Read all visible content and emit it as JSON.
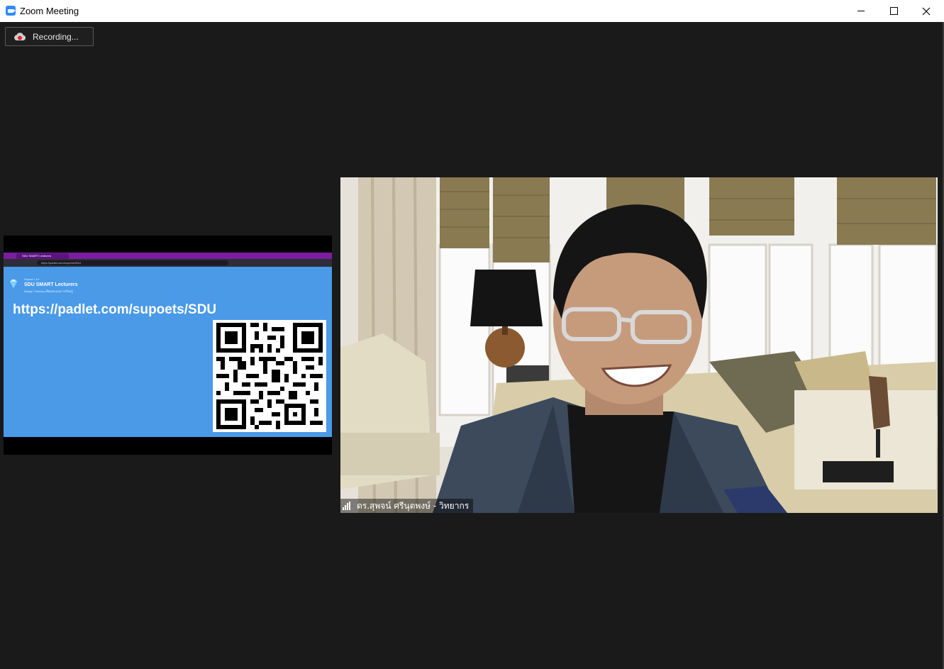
{
  "window": {
    "title": "Zoom Meeting",
    "icon": "zoom-camera-icon",
    "controls": [
      "minimize-icon",
      "maximize-icon",
      "close-icon"
    ]
  },
  "recording": {
    "label": "Recording...",
    "icon": "cloud-record-icon",
    "color": "#e02828"
  },
  "shared_screen": {
    "browser": {
      "tab_label": "SDU SMART Lecturers",
      "address": "https://padlet.com/supoets/SDU",
      "tabbar_color": "#7a1ea0"
    },
    "board": {
      "author": "Supoet • 1d",
      "title": "SDU SMART Lecturers",
      "subtitle": "Design Thinking เพื่อออกแบบการเรียนรู้",
      "icon": "diamond-gem-icon",
      "background": "#4a9ae8"
    },
    "url_text": "https://padlet.com/supoets/SDU",
    "qr_code": "qr-code-image"
  },
  "participant": {
    "name": "ดร.สุพจน์ ศรีนุตพงษ์ - วิทยากร",
    "signal_icon": "signal-strength-icon"
  },
  "colors": {
    "background": "#1a1a1a",
    "zoom_blue": "#2d8cff"
  }
}
